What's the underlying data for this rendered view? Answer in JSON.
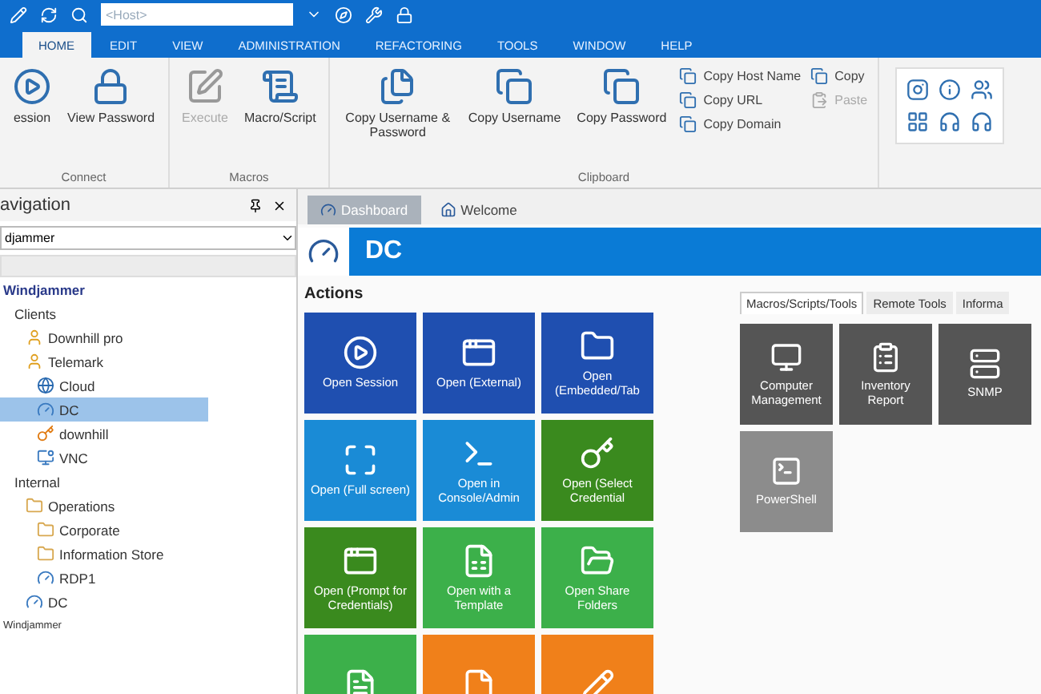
{
  "quick_access": {
    "host_field": {
      "placeholder": "<Host>"
    }
  },
  "ribbon": {
    "tabs": [
      {
        "label": "HOME",
        "selected": true
      },
      {
        "label": "EDIT",
        "selected": false
      },
      {
        "label": "VIEW",
        "selected": false
      },
      {
        "label": "ADMINISTRATION",
        "selected": false
      },
      {
        "label": "REFACTORING",
        "selected": false
      },
      {
        "label": "TOOLS",
        "selected": false
      },
      {
        "label": "WINDOW",
        "selected": false
      },
      {
        "label": "HELP",
        "selected": false
      }
    ],
    "groups": [
      {
        "label": "Connect",
        "buttons": [
          {
            "label": "ession",
            "disabled": false
          },
          {
            "label": "View Password",
            "disabled": false
          }
        ]
      },
      {
        "label": "Macros",
        "buttons": [
          {
            "label": "Execute",
            "disabled": true
          },
          {
            "label": "Macro/Script",
            "disabled": false
          }
        ]
      },
      {
        "label": "Clipboard",
        "buttons": [
          {
            "label": "Copy Username & Password",
            "disabled": false
          },
          {
            "label": "Copy Username",
            "disabled": false
          },
          {
            "label": "Copy Password",
            "disabled": false
          }
        ],
        "small_buttons": [
          {
            "label": "Copy Host Name",
            "disabled": false
          },
          {
            "label": "Copy URL",
            "disabled": false
          },
          {
            "label": "Copy Domain",
            "disabled": false
          }
        ],
        "edit_buttons": [
          {
            "label": "Copy",
            "disabled": false
          },
          {
            "label": "Paste",
            "disabled": true
          }
        ]
      }
    ]
  },
  "navigation": {
    "title": "avigation",
    "filter": {
      "value": "djammer"
    },
    "tree": [
      {
        "label": "Windjammer",
        "kind": "root",
        "selected": false,
        "children": [
          {
            "label": "Clients",
            "kind": "plain",
            "selected": false,
            "children": [
              {
                "label": "Downhill pro",
                "kind": "user",
                "selected": false
              },
              {
                "label": "Telemark",
                "kind": "user",
                "selected": false,
                "children": [
                  {
                    "label": "Cloud",
                    "kind": "globe",
                    "selected": false
                  },
                  {
                    "label": "DC",
                    "kind": "session",
                    "selected": true
                  },
                  {
                    "label": "downhill",
                    "kind": "key",
                    "selected": false
                  },
                  {
                    "label": "VNC",
                    "kind": "vnc",
                    "selected": false
                  }
                ]
              }
            ]
          },
          {
            "label": "Internal",
            "kind": "plain",
            "selected": false,
            "children": [
              {
                "label": "Operations",
                "kind": "folder",
                "selected": false,
                "children": [
                  {
                    "label": "Corporate",
                    "kind": "folder",
                    "selected": false
                  },
                  {
                    "label": "Information Store",
                    "kind": "folder",
                    "selected": false
                  },
                  {
                    "label": "RDP1",
                    "kind": "session",
                    "selected": false
                  }
                ]
              },
              {
                "label": "DC",
                "kind": "session",
                "selected": false
              }
            ]
          }
        ]
      },
      {
        "label": "Windjammer",
        "kind": "small",
        "selected": false
      }
    ]
  },
  "document_tabs": [
    {
      "label": "Dashboard",
      "selected": true
    },
    {
      "label": "Welcome",
      "selected": false
    }
  ],
  "header": {
    "title": "DC"
  },
  "actions": {
    "title": "Actions",
    "tiles": [
      {
        "label": "Open Session",
        "color": "#1f4fb0"
      },
      {
        "label": "Open (External)",
        "color": "#1f4fb0"
      },
      {
        "label": "Open (Embedded/Tab",
        "color": "#1f4fb0"
      },
      {
        "label": "Open (Full screen)",
        "color": "#1a8bd6"
      },
      {
        "label": "Open in Console/Admin",
        "color": "#1a8bd6"
      },
      {
        "label": "Open (Select Credential",
        "color": "#3a8a1e"
      },
      {
        "label": "Open (Prompt for Credentials)",
        "color": "#3a8a1e"
      },
      {
        "label": "Open with a Template",
        "color": "#3cb04a"
      },
      {
        "label": "Open Share Folders",
        "color": "#3cb04a"
      },
      {
        "color": "#3cb04a"
      },
      {
        "color": "#f0801a"
      },
      {
        "color": "#f0801a"
      }
    ]
  },
  "tools": {
    "tabs": [
      {
        "label": "Macros/Scripts/Tools",
        "selected": true
      },
      {
        "label": "Remote Tools",
        "selected": false
      },
      {
        "label": "Informa",
        "selected": false
      }
    ],
    "tiles": [
      {
        "label": "Computer Management",
        "color": "#555555"
      },
      {
        "label": "Inventory Report",
        "color": "#555555"
      },
      {
        "label": "SNMP",
        "color": "#555555"
      },
      {
        "label": "PowerShell",
        "color": "#8c8c8c"
      }
    ]
  }
}
